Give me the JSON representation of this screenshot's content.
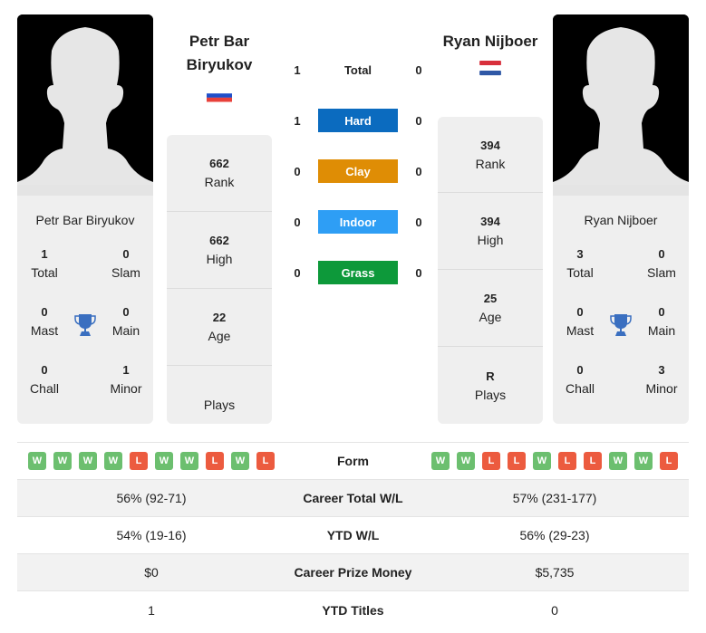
{
  "player1": {
    "name": "Petr Bar Biryukov",
    "header_name_line1": "Petr Bar",
    "header_name_line2": "Biryukov",
    "flag": "russia-flag",
    "flag_colors": [
      "#ffffff",
      "#1f4ec9",
      "#e8403a"
    ],
    "titles": {
      "total": {
        "value": "1",
        "label": "Total"
      },
      "slam": {
        "value": "0",
        "label": "Slam"
      },
      "mast": {
        "value": "0",
        "label": "Mast"
      },
      "main": {
        "value": "0",
        "label": "Main"
      },
      "chall": {
        "value": "0",
        "label": "Chall"
      },
      "minor": {
        "value": "1",
        "label": "Minor"
      }
    },
    "stats": {
      "rank": {
        "value": "662",
        "label": "Rank"
      },
      "high": {
        "value": "662",
        "label": "High"
      },
      "age": {
        "value": "22",
        "label": "Age"
      },
      "plays": {
        "value": "",
        "label": "Plays"
      }
    },
    "form": [
      "W",
      "W",
      "W",
      "W",
      "L",
      "W",
      "W",
      "L",
      "W",
      "L"
    ]
  },
  "player2": {
    "name": "Ryan Nijboer",
    "header_name": "Ryan Nijboer",
    "flag": "netherlands-flag",
    "flag_colors": [
      "#d8303c",
      "#ffffff",
      "#2f58a6"
    ],
    "titles": {
      "total": {
        "value": "3",
        "label": "Total"
      },
      "slam": {
        "value": "0",
        "label": "Slam"
      },
      "mast": {
        "value": "0",
        "label": "Mast"
      },
      "main": {
        "value": "0",
        "label": "Main"
      },
      "chall": {
        "value": "0",
        "label": "Chall"
      },
      "minor": {
        "value": "3",
        "label": "Minor"
      }
    },
    "stats": {
      "rank": {
        "value": "394",
        "label": "Rank"
      },
      "high": {
        "value": "394",
        "label": "High"
      },
      "age": {
        "value": "25",
        "label": "Age"
      },
      "plays": {
        "value": "R",
        "label": "Plays"
      }
    },
    "form": [
      "W",
      "W",
      "L",
      "L",
      "W",
      "L",
      "L",
      "W",
      "W",
      "L"
    ]
  },
  "h2h": [
    {
      "label": "Total",
      "p1": "1",
      "p2": "0",
      "color": ""
    },
    {
      "label": "Hard",
      "p1": "1",
      "p2": "0",
      "color": "#0b6bbf"
    },
    {
      "label": "Clay",
      "p1": "0",
      "p2": "0",
      "color": "#df8d05"
    },
    {
      "label": "Indoor",
      "p1": "0",
      "p2": "0",
      "color": "#2e9ef5"
    },
    {
      "label": "Grass",
      "p1": "0",
      "p2": "0",
      "color": "#0d993a"
    }
  ],
  "table": {
    "form_label": "Form",
    "rows": [
      {
        "label": "Career Total W/L",
        "p1": "56% (92-71)",
        "p2": "57% (231-177)"
      },
      {
        "label": "YTD W/L",
        "p1": "54% (19-16)",
        "p2": "56% (29-23)"
      },
      {
        "label": "Career Prize Money",
        "p1": "$0",
        "p2": "$5,735"
      },
      {
        "label": "YTD Titles",
        "p1": "1",
        "p2": "0"
      }
    ]
  },
  "colors": {
    "win": "#6cbf6f",
    "loss": "#ec5b3f",
    "trophy": "#3a6fc0",
    "card_bg": "#efefef"
  }
}
